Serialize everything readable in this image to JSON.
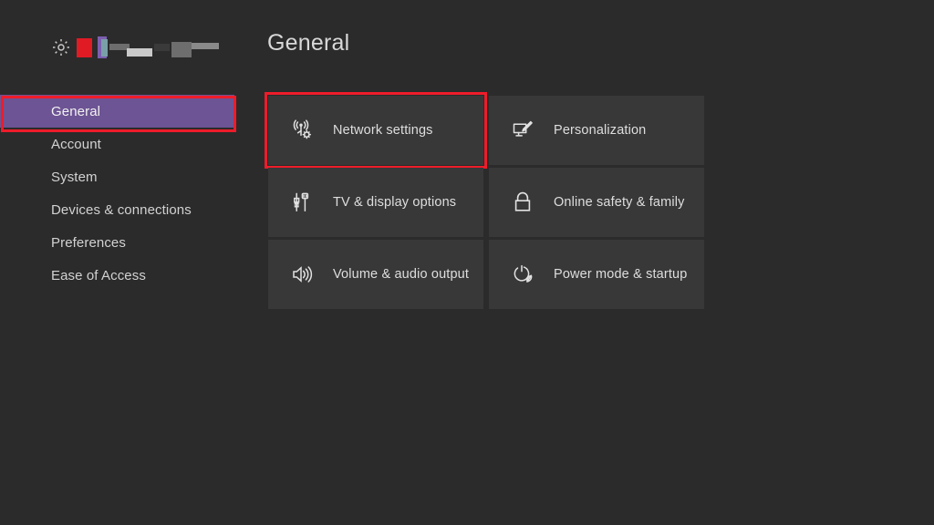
{
  "app": {
    "background_color": "#2b2b2b",
    "tile_color": "#383838",
    "accent_purple": "#6d5494",
    "focus_red": "#ee1c2a",
    "text_color": "#dedede"
  },
  "header": {
    "title": "General",
    "icons": [
      {
        "name": "gear-icon",
        "label": "Settings"
      },
      {
        "name": "app-chip-red",
        "label": ""
      },
      {
        "name": "app-chip-split",
        "label": ""
      }
    ],
    "obscured_segments": [
      {
        "name": "blurred-text-segment-1"
      },
      {
        "name": "blurred-text-segment-2"
      },
      {
        "name": "blurred-text-segment-3"
      },
      {
        "name": "blurred-text-segment-4"
      },
      {
        "name": "blurred-text-segment-5"
      }
    ]
  },
  "sidebar": {
    "items": [
      {
        "label": "General",
        "selected": true,
        "focused": true
      },
      {
        "label": "Account",
        "selected": false,
        "focused": false
      },
      {
        "label": "System",
        "selected": false,
        "focused": false
      },
      {
        "label": "Devices & connections",
        "selected": false,
        "focused": false
      },
      {
        "label": "Preferences",
        "selected": false,
        "focused": false
      },
      {
        "label": "Ease of Access",
        "selected": false,
        "focused": false
      }
    ]
  },
  "main": {
    "tiles": [
      {
        "label": "Network settings",
        "icon": "network-antenna-gear-icon",
        "focused": true
      },
      {
        "label": "Personalization",
        "icon": "monitor-pencil-icon",
        "focused": false
      },
      {
        "label": "TV & display options",
        "icon": "cable-connector-icon",
        "focused": false
      },
      {
        "label": "Online safety & family",
        "icon": "padlock-icon",
        "focused": false
      },
      {
        "label": "Volume & audio output",
        "icon": "speaker-waves-icon",
        "focused": false
      },
      {
        "label": "Power mode & startup",
        "icon": "power-leaf-icon",
        "focused": false
      }
    ]
  }
}
